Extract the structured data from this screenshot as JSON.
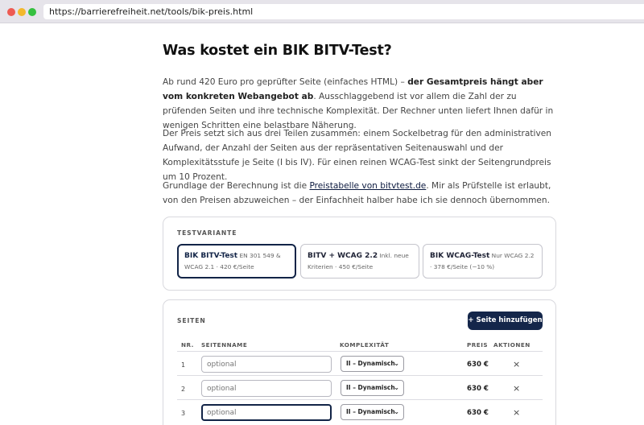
{
  "browser": {
    "url": "https://barrierefreiheit.net/tools/bik-preis.html"
  },
  "article": {
    "title": "Was kostet ein BIK BITV-Test?",
    "p1_a": "Ab rund 420 Euro pro geprüfter Seite (einfaches HTML) – ",
    "p1_b": "der Gesamtpreis hängt aber vom konkreten Webangebot ab",
    "p1_c": ". Ausschlaggebend ist vor allem die Zahl der zu prüfenden Seiten und ihre technische Komplexität. Der Rechner unten liefert Ihnen dafür in wenigen Schritten eine belastbare Näherung.",
    "p2": "Der Preis setzt sich aus drei Teilen zusammen: einem Sockelbetrag für den administrativen Aufwand, der Anzahl der Seiten aus der repräsentativen Seitenauswahl und der Komplexitätsstufe je Seite (I bis IV). Für einen reinen WCAG-Test sinkt der Seitengrundpreis um 10 Prozent.",
    "p3_a": "Grundlage der Berechnung ist die ",
    "p3_link": "Preistabelle von bitvtest.de",
    "p3_b": ". Mir als Prüfstelle ist erlaubt, von den Preisen abzuweichen – der Einfachheit halber habe ich sie dennoch übernommen."
  },
  "variants": {
    "label": "TESTVARIANTE",
    "items": [
      {
        "title": "BIK BITV-Test",
        "desc": " EN 301 549 & WCAG 2.1 · 420 €/Seite",
        "selected": true
      },
      {
        "title": "BITV + WCAG 2.2",
        "desc": " Inkl. neue Kriterien · 450 €/Seite",
        "selected": false
      },
      {
        "title": "BIK WCAG-Test",
        "desc": " Nur WCAG 2.2 · 378 €/Seite (−10 %)",
        "selected": false
      }
    ]
  },
  "pages": {
    "label": "SEITEN",
    "add_button": "+ Seite hinzufügen",
    "columns": {
      "nr": "NR.",
      "name": "SEITENNAME",
      "complexity": "KOMPLEXITÄT",
      "price": "PREIS",
      "actions": "AKTIONEN"
    },
    "rows": [
      {
        "nr": "1",
        "placeholder": "optional",
        "complexity": "II – Dynamisch",
        "price": "630 €",
        "delete": "×"
      },
      {
        "nr": "2",
        "placeholder": "optional",
        "complexity": "II – Dynamisch",
        "price": "630 €",
        "delete": "×"
      },
      {
        "nr": "3",
        "placeholder": "optional",
        "complexity": "II – Dynamisch",
        "price": "630 €",
        "delete": "×"
      }
    ]
  },
  "colors": {
    "accent": "#14264a",
    "border": "#d9d9de",
    "text": "#454545"
  }
}
